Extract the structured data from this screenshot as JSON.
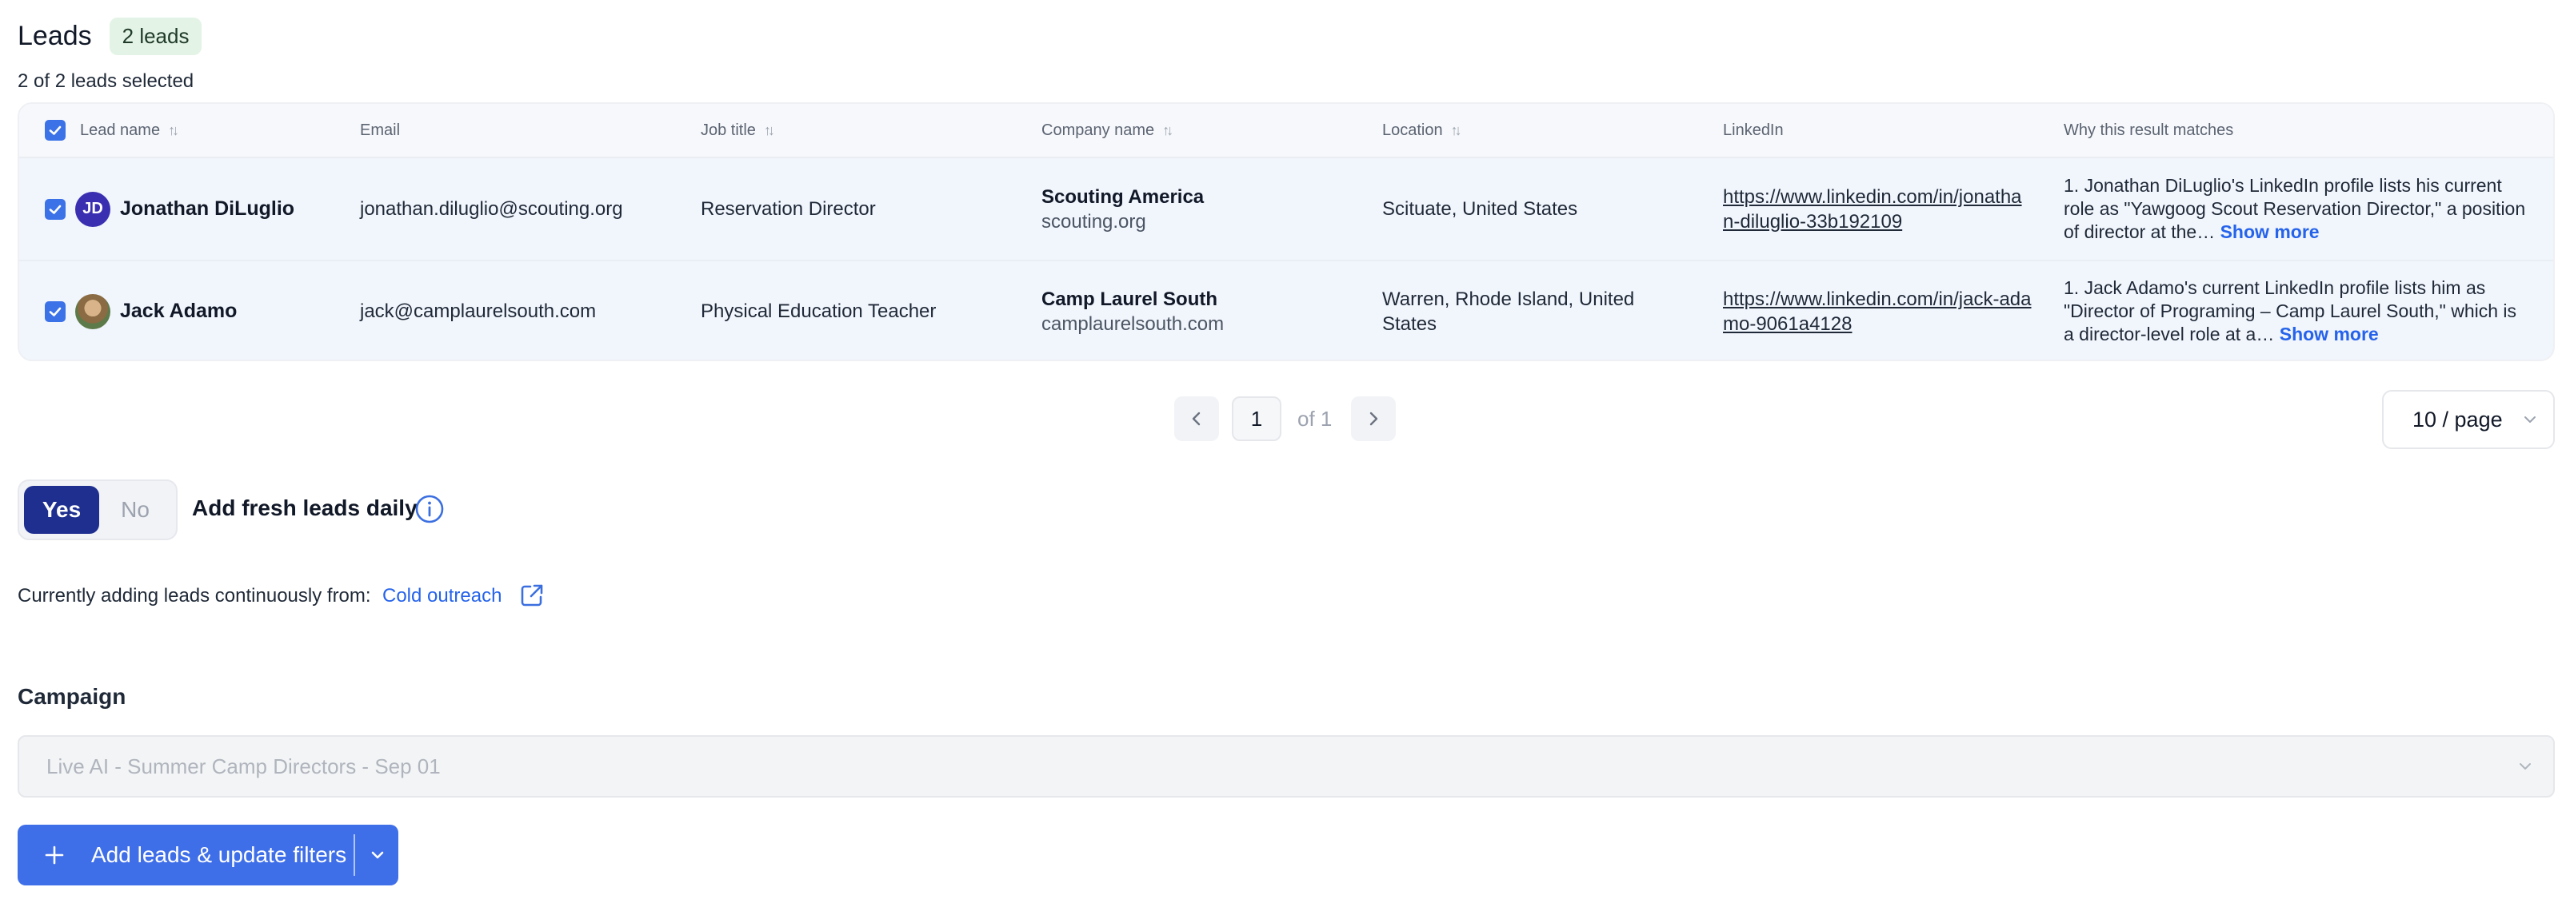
{
  "header": {
    "title": "Leads",
    "count_badge": "2 leads",
    "selected_text": "2 of 2 leads selected"
  },
  "table": {
    "columns": [
      "Lead name",
      "Email",
      "Job title",
      "Company name",
      "Location",
      "LinkedIn",
      "Why this result matches"
    ],
    "rows": [
      {
        "initials": "JD",
        "name": "Jonathan DiLuglio",
        "email": "jonathan.diluglio@scouting.org",
        "job_title": "Reservation Director",
        "company_name": "Scouting America",
        "company_domain": "scouting.org",
        "location": "Scituate, United States",
        "linkedin": "https://www.linkedin.com/in/jonathan-diluglio-33b192109",
        "why": "1. Jonathan DiLuglio's LinkedIn profile lists his current role as \"Yawgoog Scout Reservation Director,\" a position of director at the…",
        "show_more": "Show more"
      },
      {
        "initials": "",
        "name": "Jack Adamo",
        "email": "jack@camplaurelsouth.com",
        "job_title": "Physical Education Teacher",
        "company_name": "Camp Laurel South",
        "company_domain": "camplaurelsouth.com",
        "location": "Warren, Rhode Island, United States",
        "linkedin": "https://www.linkedin.com/in/jack-adamo-9061a4128",
        "why": "1. Jack Adamo's current LinkedIn profile lists him as \"Director of Programing – Camp Laurel South,\" which is a director-level role at a…",
        "show_more": "Show more"
      }
    ]
  },
  "pagination": {
    "current_page": "1",
    "of_text": "of 1",
    "per_page": "10 / page"
  },
  "toggle": {
    "yes": "Yes",
    "no": "No",
    "label": "Add fresh leads daily"
  },
  "continuous": {
    "text": "Currently adding leads continuously from:",
    "link": "Cold outreach"
  },
  "campaign": {
    "label": "Campaign",
    "value": "Live AI - Summer Camp Directors - Sep 01"
  },
  "add_button": {
    "label": "Add leads & update filters"
  },
  "colors": {
    "accent": "#3f6fe8",
    "toggle_active": "#1e2f8f",
    "badge_bg": "#e3f3e5",
    "link": "#2563eb"
  }
}
